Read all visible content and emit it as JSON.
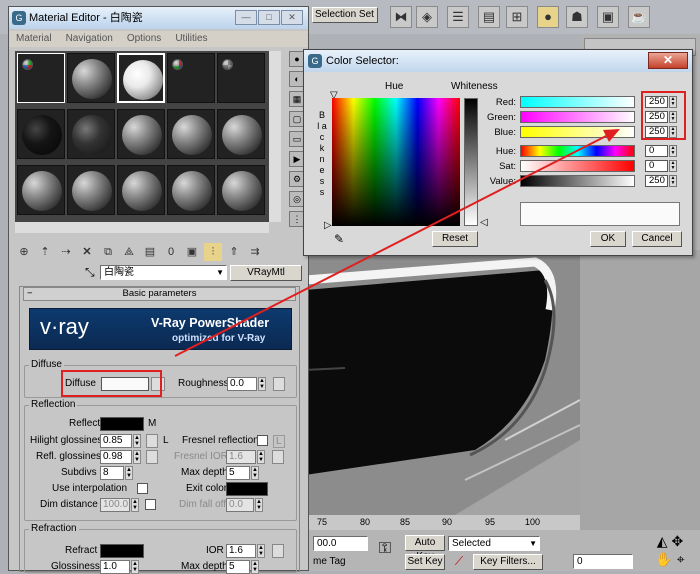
{
  "main_toolbar": {
    "selection_set_label": "Selection Set",
    "icons": [
      "mirror-icon",
      "align-icon",
      "layer-icon",
      "curve-editor-icon",
      "schematic-icon",
      "material-editor-icon",
      "render-setup-icon",
      "render-icon",
      "teapot-icon"
    ]
  },
  "material_editor": {
    "title": "Material Editor - 白陶瓷",
    "menu": [
      "Material",
      "Navigation",
      "Options",
      "Utilities"
    ],
    "material_name": "白陶瓷",
    "material_type": "VRayMtl",
    "rollout_title": "Basic parameters",
    "banner": {
      "brand": "v·ray",
      "product": "V-Ray PowerShader",
      "subtitle": "optimized for V-Ray"
    },
    "diffuse": {
      "group": "Diffuse",
      "label": "Diffuse",
      "roughness_label": "Roughness",
      "roughness": "0.0"
    },
    "reflection": {
      "group": "Reflection",
      "reflect_label": "Reflect",
      "reflect_map": "M",
      "hilight_label": "Hilight glossiness",
      "hilight": "0.85",
      "hilight_lock": "L",
      "fresnel_label": "Fresnel reflections",
      "fresnel_lock": "L",
      "refl_gloss_label": "Refl. glossiness",
      "refl_gloss": "0.98",
      "fresnel_ior_label": "Fresnel IOR",
      "fresnel_ior": "1.6",
      "subdivs_label": "Subdivs",
      "subdivs": "8",
      "max_depth_label": "Max depth",
      "max_depth": "5",
      "use_interp_label": "Use interpolation",
      "exit_color_label": "Exit color",
      "dim_distance_label": "Dim distance",
      "dim_distance": "100.0",
      "dim_falloff_label": "Dim fall off",
      "dim_falloff": "0.0"
    },
    "refraction": {
      "group": "Refraction",
      "refract_label": "Refract",
      "ior_label": "IOR",
      "ior": "1.6",
      "glossiness_label": "Glossiness",
      "glossiness": "1.0",
      "max_depth_label": "Max depth",
      "max_depth": "5"
    }
  },
  "color_selector": {
    "title": "Color Selector:",
    "hue_label": "Hue",
    "whiteness_label": "Whiteness",
    "blackness_label": "B l a c k n e s s",
    "red_label": "Red:",
    "red": "250",
    "green_label": "Green:",
    "green": "250",
    "blue_label": "Blue:",
    "blue": "250",
    "hue2_label": "Hue:",
    "hue": "0",
    "sat_label": "Sat:",
    "sat": "0",
    "value_label": "Value:",
    "value": "250",
    "reset_label": "Reset",
    "ok_label": "OK",
    "cancel_label": "Cancel"
  },
  "timeline": {
    "ticks": [
      "75",
      "80",
      "85",
      "90",
      "95",
      "100"
    ]
  },
  "bottom_bar": {
    "frame_value": "00.0",
    "set_tag_label": "me Tag",
    "auto_key_label": "Auto Key",
    "set_key_label": "Set Key",
    "selected_value": "Selected",
    "key_filters_label": "Key Filters...",
    "frame_counter": "0"
  },
  "colors": {
    "accent_red": "#e02020",
    "diffuse": "#fafafa",
    "reflect": "#000000",
    "refract": "#000000",
    "exit": "#000000"
  }
}
